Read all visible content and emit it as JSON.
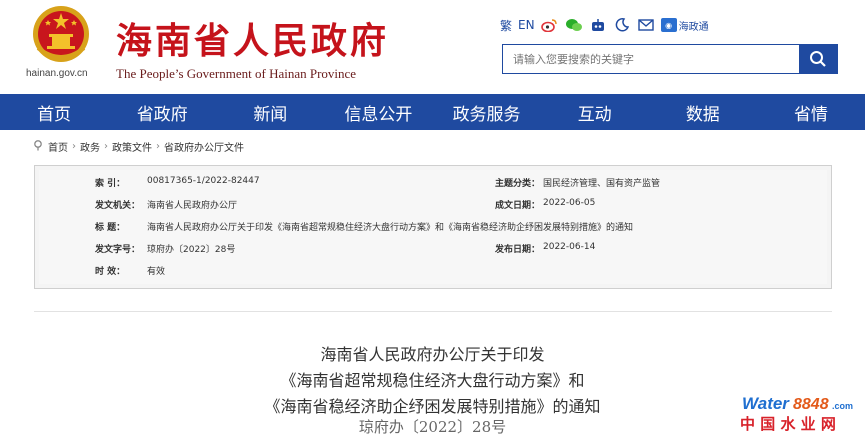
{
  "header": {
    "site_domain": "hainan.gov.cn",
    "logo_cn": "海南省人民政府",
    "logo_en": "The People’s Government  of Hainan Province",
    "lang_trad": "繁",
    "lang_en": "EN",
    "hzt_label": "海政通",
    "icons": [
      "weibo-icon",
      "wechat-icon",
      "robot-icon",
      "moon-icon",
      "mail-icon",
      "hzt-icon"
    ]
  },
  "search": {
    "placeholder": "请输入您要搜索的关键字"
  },
  "nav": {
    "items": [
      "首页",
      "省政府",
      "新闻",
      "信息公开",
      "政务服务",
      "互动",
      "数据",
      "省情"
    ]
  },
  "breadcrumb": {
    "items": [
      "首页",
      "政务",
      "政策文件",
      "省政府办公厅文件"
    ]
  },
  "info": {
    "index_label": "索    引",
    "index_value": "00817365-1/2022-82447",
    "category_label": "主题分类",
    "category_value": "国民经济管理、国有资产监管",
    "issuer_label": "发文机关",
    "issuer_value": "海南省人民政府办公厅",
    "created_label": "成文日期",
    "created_value": "2022-06-05",
    "title_label": "标    题",
    "title_value": "海南省人民政府办公厅关于印发《海南省超常规稳住经济大盘行动方案》和《海南省稳经济助企纾困发展特别措施》的通知",
    "docno_label": "发文字号",
    "docno_value": "琼府办〔2022〕28号",
    "published_label": "发布日期",
    "published_value": "2022-06-14",
    "validity_label": "时    效",
    "validity_value": "有效"
  },
  "article": {
    "title_line1": "海南省人民政府办公厅关于印发",
    "title_line2": "《海南省超常规稳住经济大盘行动方案》和",
    "title_line3": "《海南省稳经济助企纾困发展特别措施》的通知",
    "doc_number": "琼府办〔2022〕28号"
  },
  "watermark": {
    "brand_a": "Water",
    "brand_b": "8848",
    "brand_c": ".com",
    "cn": "中 国 水 业 网"
  },
  "colors": {
    "brand_blue": "#1f4aa0",
    "logo_red": "#c5131b"
  }
}
